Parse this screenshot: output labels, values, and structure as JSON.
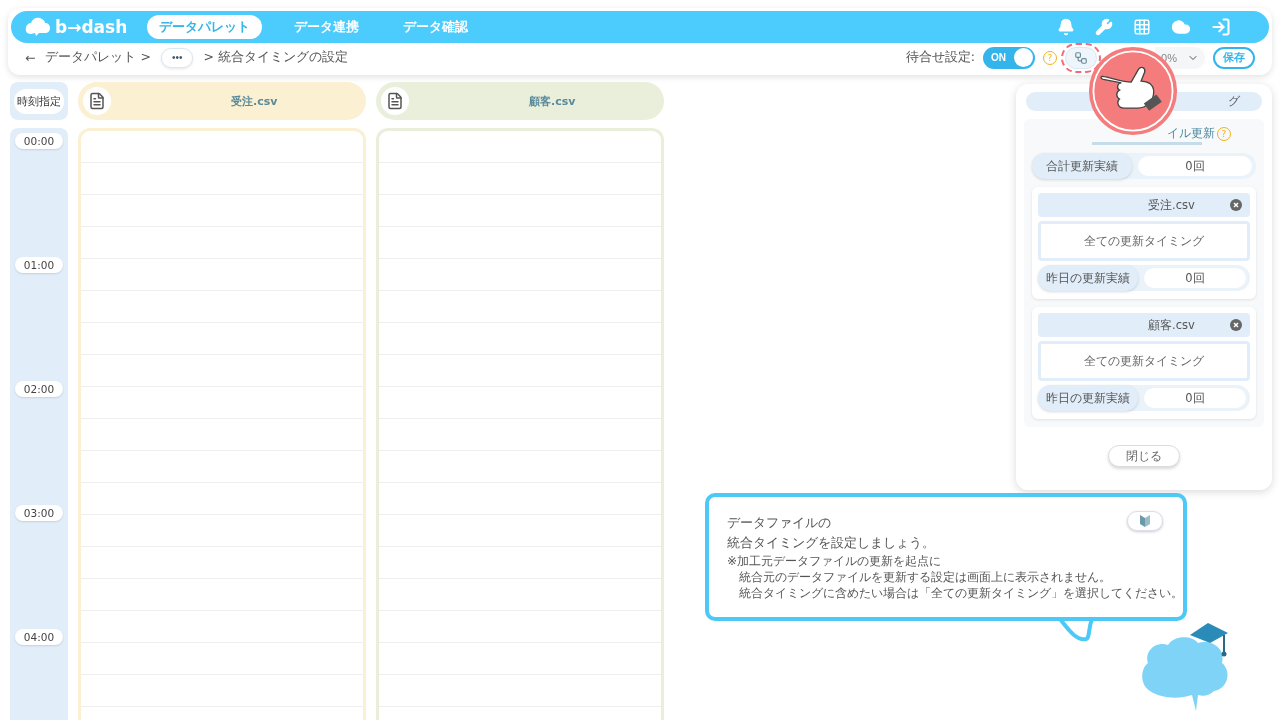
{
  "header": {
    "logo": "b→dash",
    "nav": [
      {
        "label": "データパレット",
        "selected": true
      },
      {
        "label": "データ連携",
        "selected": false
      },
      {
        "label": "データ確認",
        "selected": false
      }
    ]
  },
  "breadcrumb": {
    "back": "←",
    "items": [
      "データパレット >"
    ],
    "ellipsis": "•••",
    "current": "> 統合タイミングの設定"
  },
  "toolbar": {
    "wait_label": "待合せ設定:",
    "toggle": {
      "label": "ON",
      "on": true
    },
    "help": "?",
    "zoom": "0%",
    "save": "保存"
  },
  "timeline": {
    "header": "時刻指定",
    "hours": [
      "00:00",
      "01:00",
      "02:00",
      "03:00",
      "04:00"
    ],
    "files": [
      {
        "name": "受注.csv",
        "color": "#fbf0d2"
      },
      {
        "name": "顧客.csv",
        "color": "#eaefdc"
      }
    ]
  },
  "panel": {
    "title_fragment": "グ",
    "tab_fragment": "イル更新",
    "help": "?",
    "total": {
      "label": "合計更新実績",
      "value": "0回"
    },
    "files": [
      {
        "name": "受注.csv",
        "timing": "全ての更新タイミング",
        "yesterday_label": "昨日の更新実績",
        "yesterday_value": "0回"
      },
      {
        "name": "顧客.csv",
        "timing": "全ての更新タイミング",
        "yesterday_label": "昨日の更新実績",
        "yesterday_value": "0回"
      }
    ],
    "close": "閉じる"
  },
  "tip": {
    "title": [
      "データファイルの",
      "統合タイミングを設定しましょう。"
    ],
    "notes": [
      "※加工元データファイルの更新を起点に",
      "　統合元のデータファイルを更新する設定は画面上に表示されません。",
      "　統合タイミングに含めたい場合は「全ての更新タイミング」を選択してください。"
    ]
  }
}
